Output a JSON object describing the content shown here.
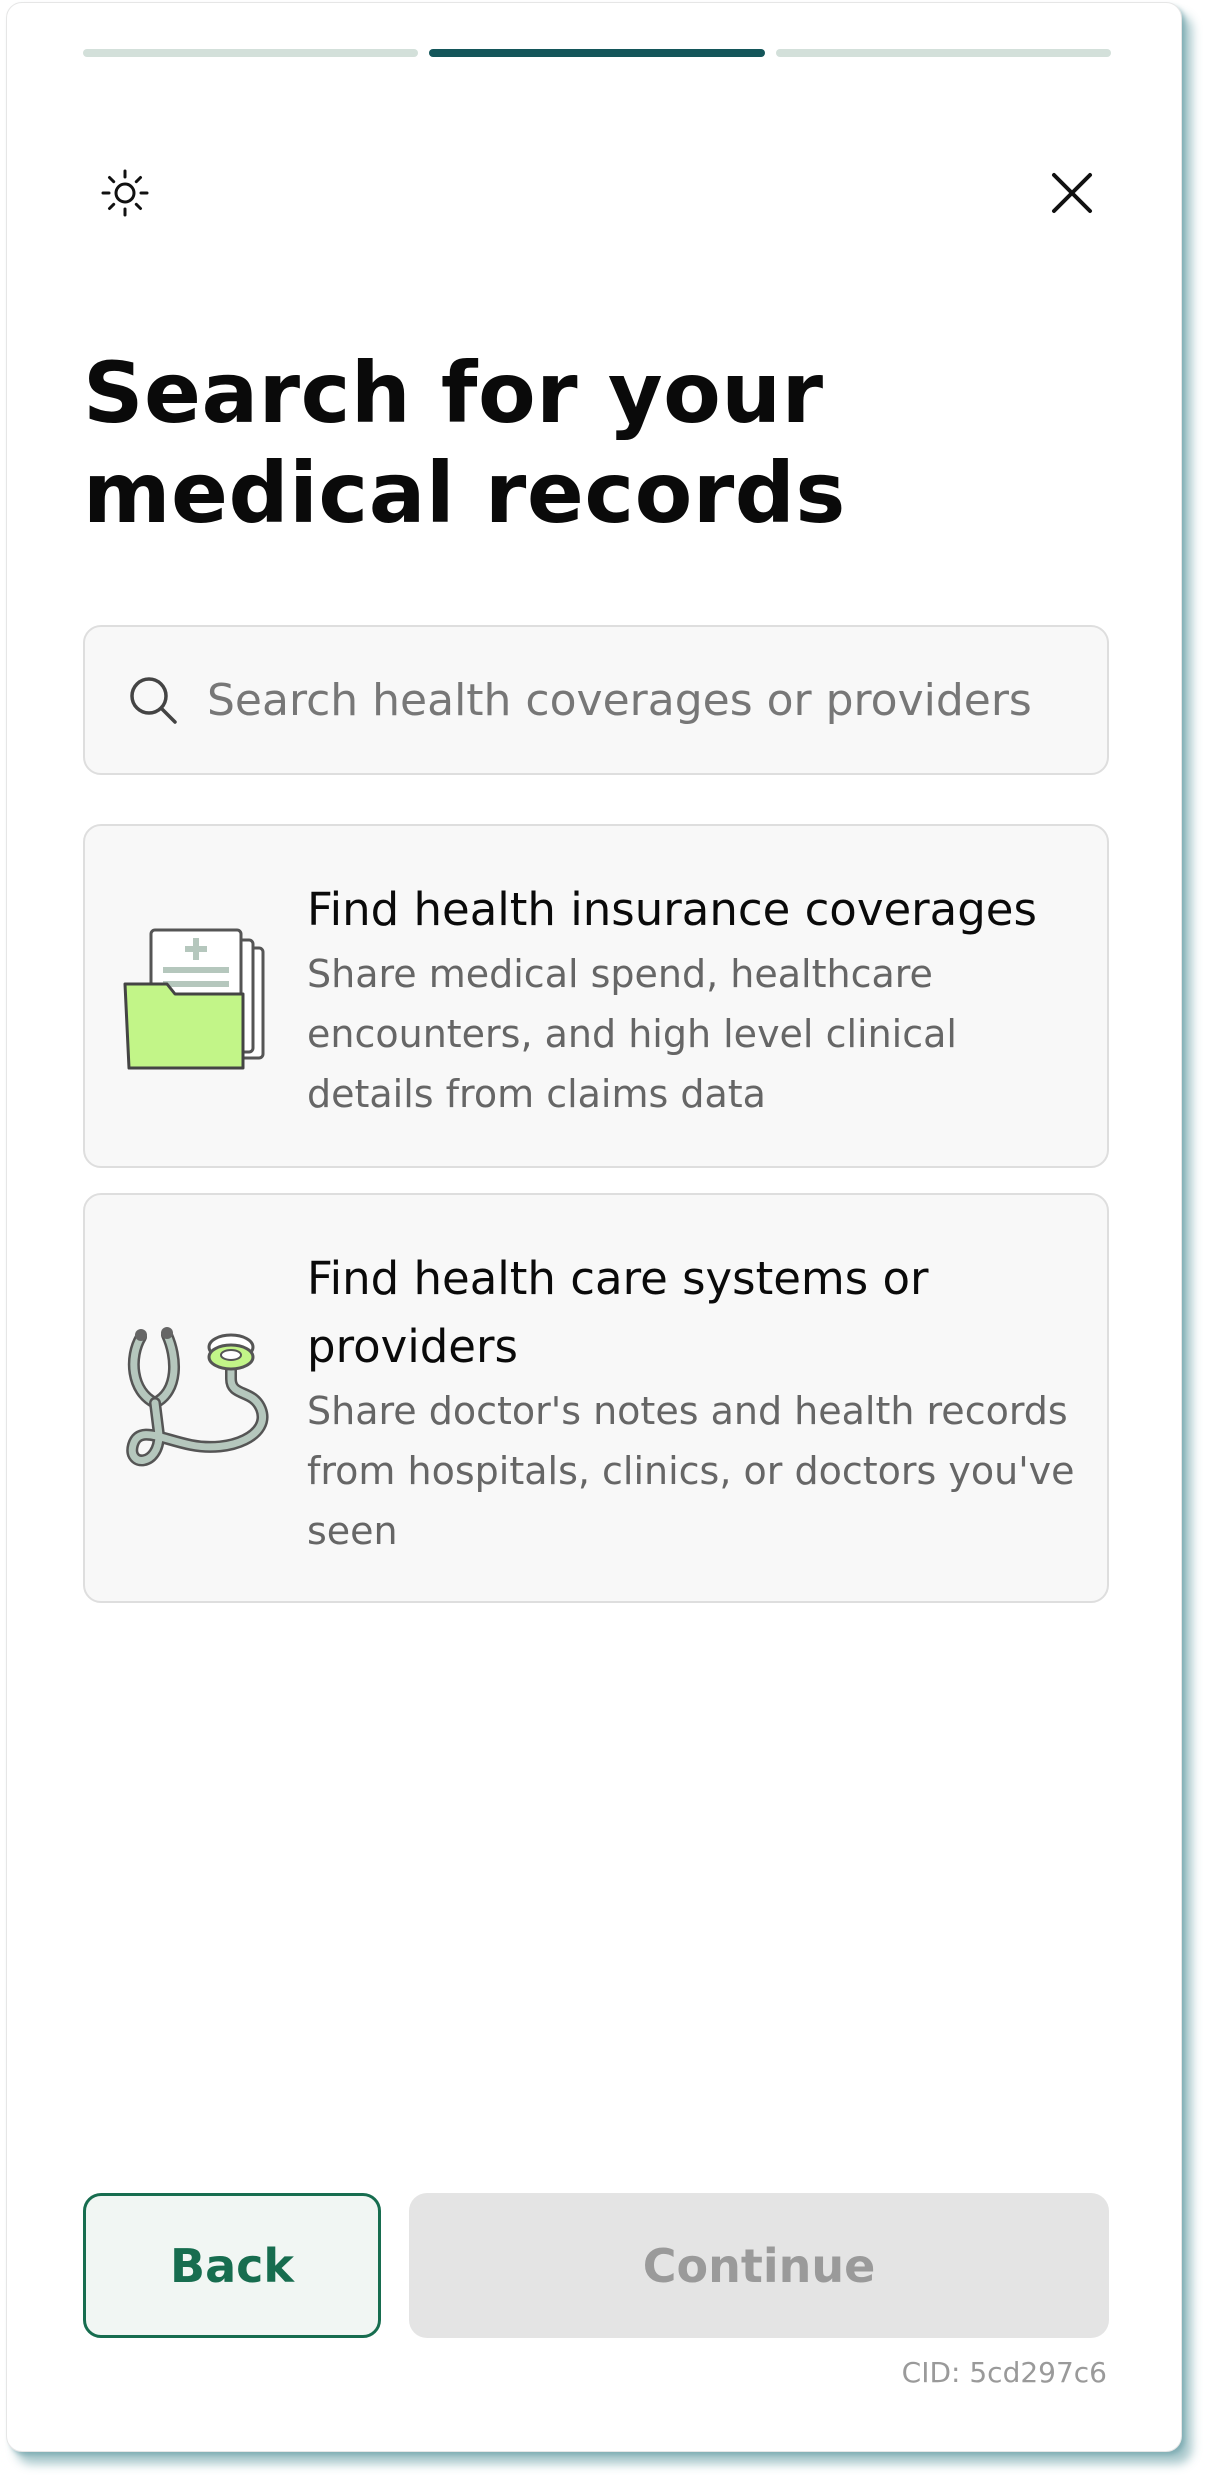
{
  "progress": {
    "steps": 3,
    "current": 2
  },
  "header": {
    "theme_icon": "sun-icon",
    "close_icon": "close-icon"
  },
  "page": {
    "title": "Search for your medical records"
  },
  "search": {
    "icon": "search-icon",
    "placeholder": "Search health coverages or providers",
    "value": ""
  },
  "options": [
    {
      "icon": "insurance-folder-illustration",
      "title": "Find health insurance coverages",
      "description": "Share medical spend, healthcare encounters, and high level clinical details from claims data"
    },
    {
      "icon": "stethoscope-illustration",
      "title": "Find health care systems or providers",
      "description": "Share doctor's notes and health records from hospitals, clinics, or doctors you've seen"
    }
  ],
  "footer": {
    "back_label": "Back",
    "continue_label": "Continue",
    "continue_enabled": false,
    "cid": "CID: 5cd297c6"
  },
  "colors": {
    "progress_active": "#14565a",
    "progress_inactive": "#d3e0da",
    "brand_green": "#176d4f",
    "folder_green": "#c2f588"
  }
}
